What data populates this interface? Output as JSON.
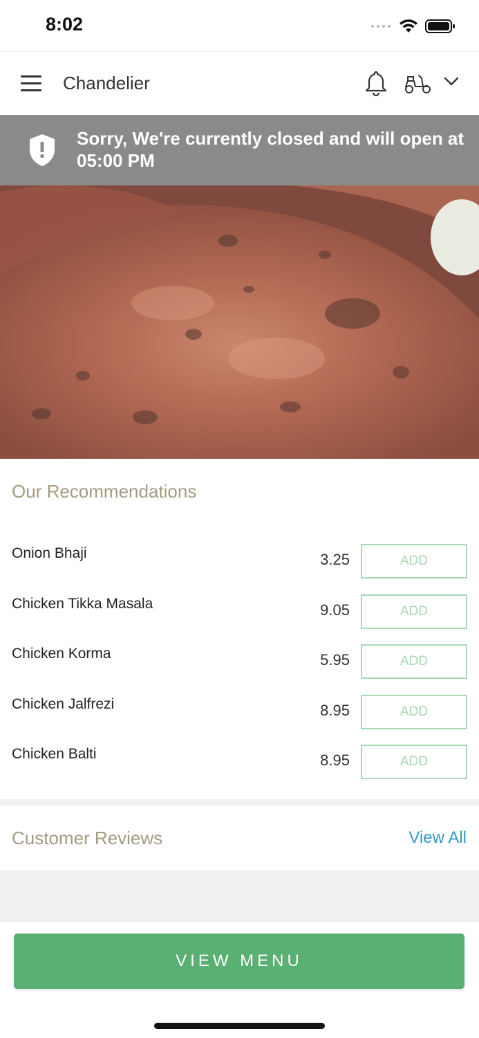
{
  "status_bar": {
    "time": "8:02"
  },
  "header": {
    "title": "Chandelier"
  },
  "notice": {
    "text": "Sorry, We're currently closed and will open at 05:00 PM"
  },
  "recommendations": {
    "title": "Our Recommendations",
    "add_label": "ADD",
    "items": [
      {
        "name": "Onion Bhaji",
        "price": "3.25"
      },
      {
        "name": "Chicken Tikka Masala",
        "price": "9.05"
      },
      {
        "name": "Chicken Korma",
        "price": "5.95"
      },
      {
        "name": "Chicken Jalfrezi",
        "price": "8.95"
      },
      {
        "name": "Chicken Balti",
        "price": "8.95"
      }
    ]
  },
  "reviews": {
    "title": "Customer Reviews",
    "view_all": "View All"
  },
  "footer": {
    "view_menu": "VIEW MENU"
  },
  "icons": {
    "menu": "hamburger-menu-icon",
    "notifications": "bell-icon",
    "delivery": "scooter-icon",
    "dropdown": "chevron-down-icon",
    "alert": "shield-alert-icon"
  },
  "colors": {
    "accent_green": "#5aaf73",
    "add_border": "#a8d8b4",
    "heading_tan": "#a59a82",
    "link_blue": "#3499c6",
    "banner_gray": "#8a8a8a"
  }
}
